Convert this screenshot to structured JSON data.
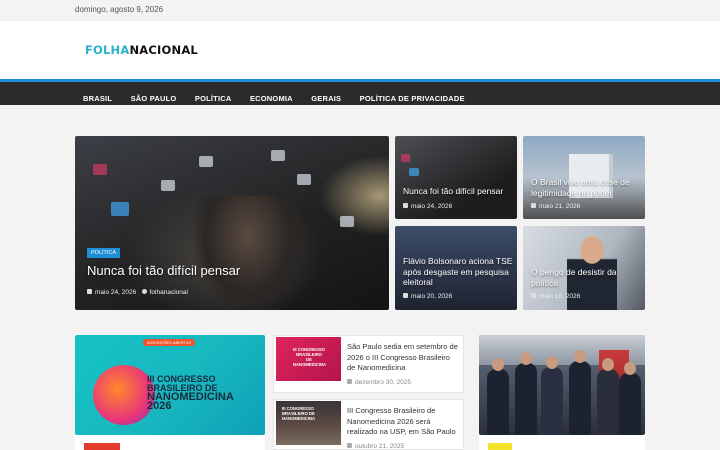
{
  "topbar": {
    "date": "domingo, agosto 9, 2026"
  },
  "logo": {
    "part1": "FOLHA",
    "part2": "NACIONAL"
  },
  "nav": [
    "BRASIL",
    "SÃO PAULO",
    "POLÍTICA",
    "ECONOMIA",
    "GERAIS",
    "POLÍTICA DE PRIVACIDADE"
  ],
  "colors": {
    "accent": "#1e8fd6",
    "nav_bg": "#2b2b2b",
    "logo_cyan": "#2ab1c8"
  },
  "featured": {
    "category": "POLÍTICA",
    "title": "Nunca foi tão difícil pensar",
    "date": "maio 24, 2026",
    "author": "folhanacional"
  },
  "grid": [
    {
      "title": "Nunca foi tão difícil pensar",
      "date": "maio 24, 2026"
    },
    {
      "title": "O Brasil vive uma crise de legitimidade no poder",
      "date": "maio 21, 2026"
    },
    {
      "title": "Flávio Bolsonaro aciona TSE após desgaste em pesquisa eleitoral",
      "date": "maio 20, 2026"
    },
    {
      "title": "O perigo de desistir da política",
      "date": "maio 18, 2026"
    }
  ],
  "lower_left": {
    "ribbon": "INSCRIÇÕES ABERTAS",
    "line1": "III CONGRESSO",
    "line2": "BRASILEIRO DE",
    "line3": "NANOMEDICINA",
    "line4": "2026"
  },
  "middle_list": [
    {
      "thumb_text": "III CONGRESSO BRASILEIRO DE NANOMEDICINA",
      "title": "São Paulo sedia em setembro de 2026 o III Congresso Brasileiro de Nanomedicina",
      "date": "dezembro 30, 2025"
    },
    {
      "thumb_text": "III CONGRESSO BRASILEIRO DE NANOMEDICINA",
      "title": "III Congresso Brasileiro de Nanomedicina 2026 será realizado na USP, em São Paulo",
      "date": "outubro 21, 2025"
    }
  ]
}
